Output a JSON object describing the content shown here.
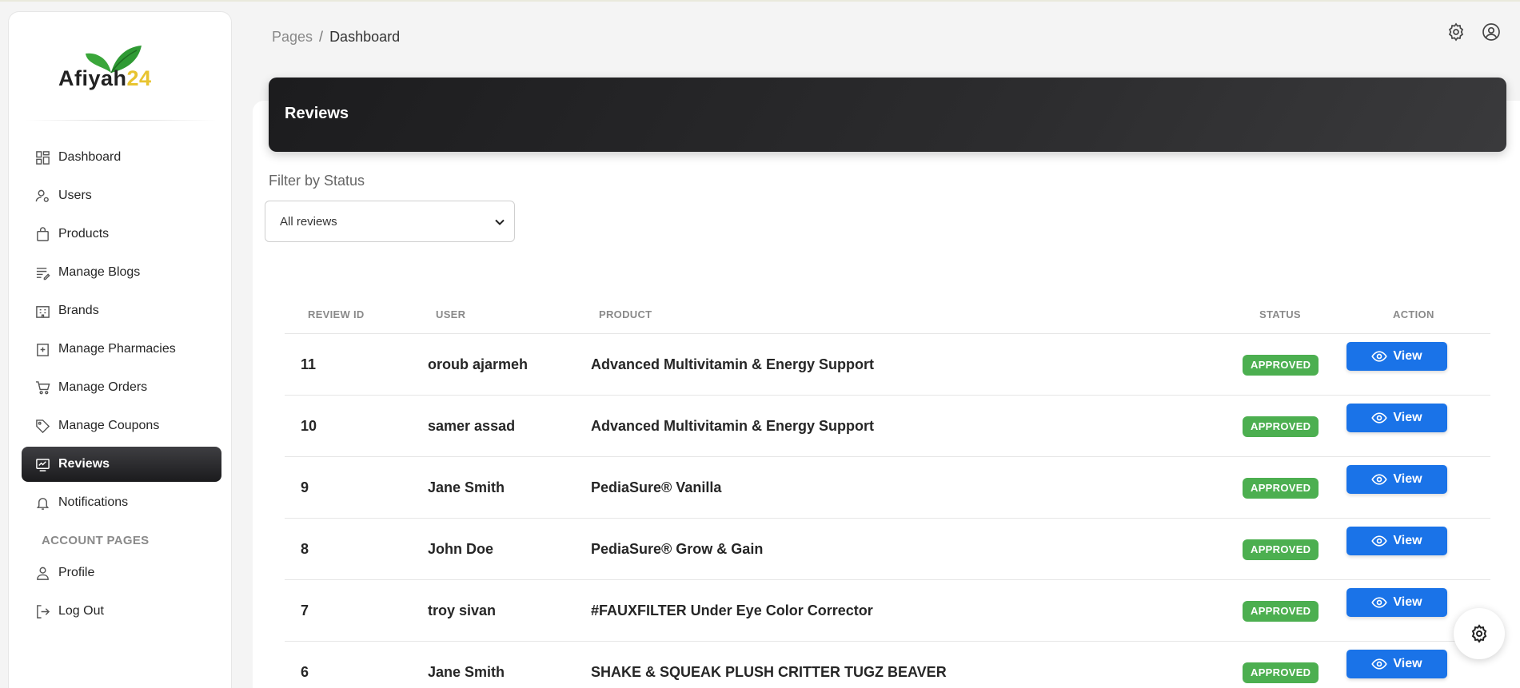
{
  "brand": {
    "name": "Afiyah",
    "number": "24"
  },
  "breadcrumb": {
    "parent": "Pages",
    "separator": "/",
    "current": "Dashboard"
  },
  "sidebar": {
    "items": [
      {
        "label": "Dashboard",
        "icon": "dashboard-grid-icon"
      },
      {
        "label": "Users",
        "icon": "user-gear-icon"
      },
      {
        "label": "Products",
        "icon": "shopping-bag-icon"
      },
      {
        "label": "Manage Blogs",
        "icon": "edit-list-icon"
      },
      {
        "label": "Brands",
        "icon": "building-icon"
      },
      {
        "label": "Manage Pharmacies",
        "icon": "pharmacy-icon"
      },
      {
        "label": "Manage Orders",
        "icon": "cart-icon"
      },
      {
        "label": "Manage Coupons",
        "icon": "tag-icon"
      },
      {
        "label": "Reviews",
        "icon": "review-icon",
        "active": true
      },
      {
        "label": "Notifications",
        "icon": "bell-icon"
      }
    ],
    "section_label": "ACCOUNT PAGES",
    "account_items": [
      {
        "label": "Profile",
        "icon": "user-icon"
      },
      {
        "label": "Log Out",
        "icon": "logout-icon"
      }
    ]
  },
  "main": {
    "title": "Reviews",
    "filter": {
      "label": "Filter by Status",
      "selected": "All reviews"
    },
    "table": {
      "headers": {
        "id": "REVIEW ID",
        "user": "USER",
        "product": "PRODUCT",
        "status": "STATUS",
        "action": "ACTION"
      },
      "rows": [
        {
          "id": "11",
          "user": "oroub ajarmeh",
          "product": "Advanced Multivitamin & Energy Support",
          "status": "APPROVED",
          "action": "View"
        },
        {
          "id": "10",
          "user": "samer assad",
          "product": "Advanced Multivitamin & Energy Support",
          "status": "APPROVED",
          "action": "View"
        },
        {
          "id": "9",
          "user": "Jane Smith",
          "product": "PediaSure® Vanilla",
          "status": "APPROVED",
          "action": "View"
        },
        {
          "id": "8",
          "user": "John Doe",
          "product": "PediaSure® Grow & Gain",
          "status": "APPROVED",
          "action": "View"
        },
        {
          "id": "7",
          "user": "troy sivan",
          "product": "#FAUXFILTER Under Eye Color Corrector",
          "status": "APPROVED",
          "action": "View"
        },
        {
          "id": "6",
          "user": "Jane Smith",
          "product": "SHAKE & SQUEAK PLUSH CRITTER TUGZ BEAVER",
          "status": "APPROVED",
          "action": "View"
        }
      ]
    }
  },
  "colors": {
    "accent": "#1a73e8",
    "status_approved": "#4caf50",
    "active_nav": "#1b1b1d",
    "logo_leaf": "#3aa63a",
    "logo_number": "#e8c430"
  }
}
